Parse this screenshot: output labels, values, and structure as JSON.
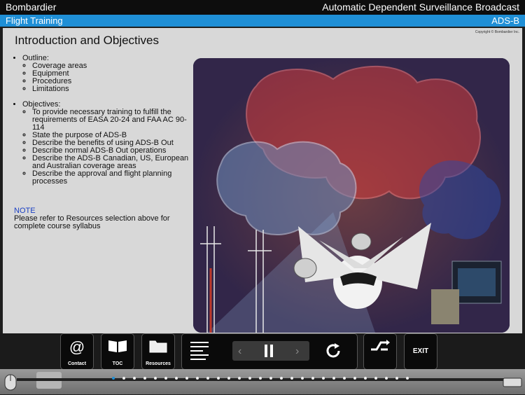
{
  "header": {
    "brand": "Bombardier",
    "course_title": "Automatic Dependent Surveillance Broadcast",
    "section": "Flight Training",
    "module": "ADS-B"
  },
  "page": {
    "copyright": "Copyright © Bombardier Inc.",
    "title": "Introduction and Objectives",
    "outline_heading": "Outline:",
    "outline_items": [
      "Coverage areas",
      "Equipment",
      "Procedures",
      "Limitations"
    ],
    "objectives_heading": "Objectives:",
    "objectives_items": [
      "To provide necessary training to fulfill the requirements of EASA 20-24 and FAA AC 90-114",
      "State the purpose of ADS-B",
      "Describe the benefits of using ADS-B Out",
      "Describe normal ADS-B Out operations",
      "Describe the ADS-B Canadian, US, European and Australian coverage areas",
      "Describe the approval and flight planning processes"
    ],
    "note_label": "NOTE",
    "note_text": "Please refer to Resources selection above for complete course syllabus"
  },
  "toolbar": {
    "contact_label": "Contact",
    "toc_label": "TOC",
    "resources_label": "Resources",
    "exit_label": "EXIT"
  },
  "progress": {
    "total_pages": 29,
    "current_page": 1
  },
  "colors": {
    "header_bar": "#0d0d0d",
    "section_bar": "#1f8fd6",
    "content_bg": "#d8d8d8",
    "note_label": "#1a3fc4"
  }
}
